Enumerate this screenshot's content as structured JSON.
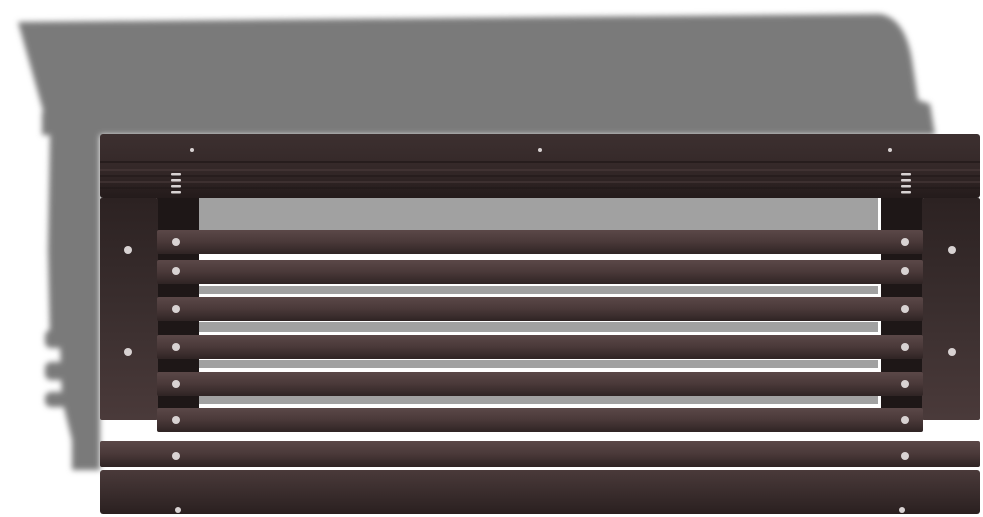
{
  "scene": {
    "subject": "bench-top-view-render",
    "colors": {
      "background": "#ffffff",
      "shadow": "#787878",
      "wood_dark": "#2f2424",
      "wood_mid": "#4a3a3a",
      "wood_light": "#5a4646",
      "bolt": "#d8d2d2"
    }
  }
}
